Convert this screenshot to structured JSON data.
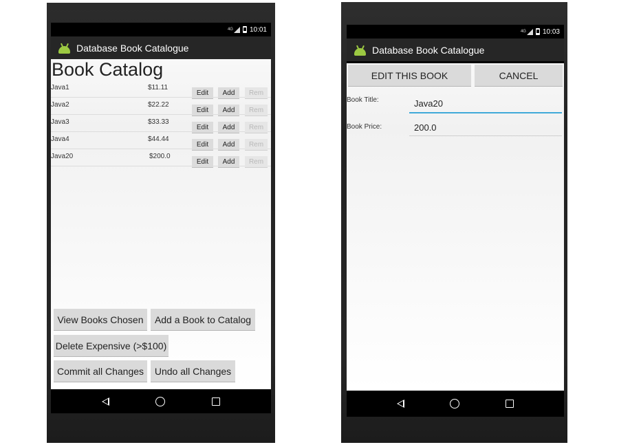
{
  "screen1": {
    "status_time": "10:01",
    "network_label": "4G",
    "app_title": "Database Book Catalogue",
    "heading": "Book Catalog",
    "books": [
      {
        "name": "Java1",
        "price": "$11.11"
      },
      {
        "name": "Java2",
        "price": "$22.22"
      },
      {
        "name": "Java3",
        "price": "$33.33"
      },
      {
        "name": "Java4",
        "price": "$44.44"
      },
      {
        "name": "Java20",
        "price": "$200.0"
      }
    ],
    "row_buttons": {
      "edit": "Edit",
      "add": "Add",
      "rem": "Rem"
    },
    "buttons": {
      "view_chosen": "View Books Chosen",
      "add_book": "Add a Book to Catalog",
      "delete_expensive": "Delete Expensive (>$100)",
      "commit": "Commit all Changes",
      "undo": "Undo all Changes"
    },
    "icons": {
      "logo": "android-icon",
      "back": "back-icon",
      "home": "home-icon",
      "recents": "recents-icon"
    }
  },
  "screen2": {
    "status_time": "10:03",
    "network_label": "4G",
    "app_title": "Database Book Catalogue",
    "buttons": {
      "edit": "EDIT THIS BOOK",
      "cancel": "CANCEL"
    },
    "fields": {
      "title_label": "Book Title:",
      "title_value": "Java20",
      "price_label": "Book Price:",
      "price_value": "200.0"
    }
  },
  "colors": {
    "android_green": "#9cc942",
    "focus_blue": "#3fa9d8",
    "button_gray": "#dadada"
  }
}
